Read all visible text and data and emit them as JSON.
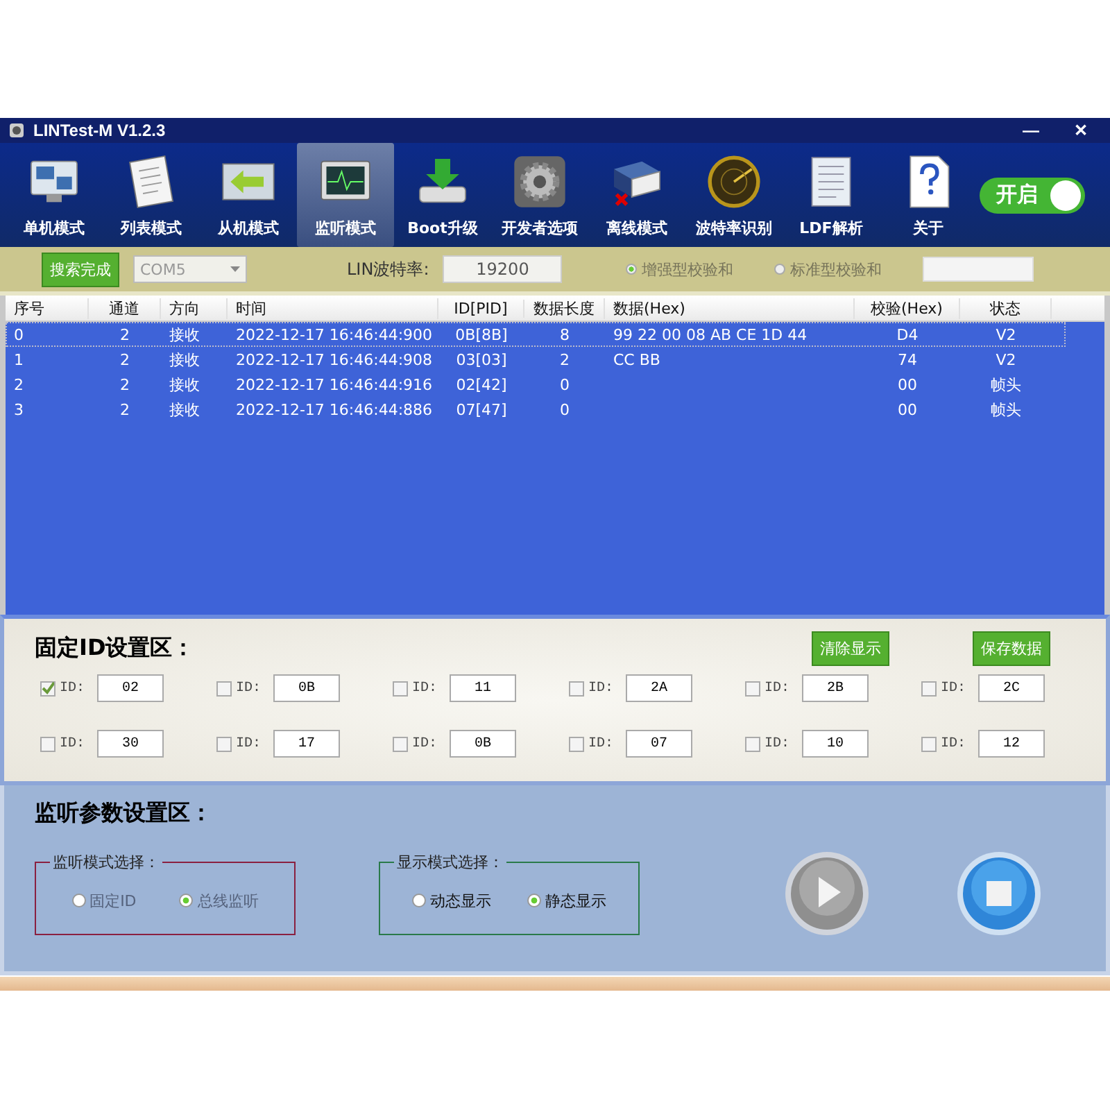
{
  "window": {
    "title": "LINTest-M V1.2.3",
    "controls": [
      "—",
      "✕"
    ]
  },
  "toolbar": {
    "items": [
      {
        "label": "单机模式",
        "selected": false
      },
      {
        "label": "列表模式",
        "selected": false
      },
      {
        "label": "从机模式",
        "selected": false
      },
      {
        "label": "监听模式",
        "selected": true
      },
      {
        "label": "Boot升级",
        "selected": false
      },
      {
        "label": "开发者选项",
        "selected": false
      },
      {
        "label": "离线模式",
        "selected": false
      },
      {
        "label": "波特率识别",
        "selected": false
      },
      {
        "label": "LDF解析",
        "selected": false
      },
      {
        "label": "关于",
        "selected": false
      }
    ],
    "toggle": {
      "label": "开启",
      "on": true
    }
  },
  "settings": {
    "search_button": "搜索完成",
    "port": {
      "value": "COM5",
      "disabled": true
    },
    "baud_label": "LIN波特率:",
    "baud_value": "19200",
    "checksum": [
      {
        "label": "增强型校验和",
        "selected": true,
        "disabled": true
      },
      {
        "label": "标准型校验和",
        "selected": false,
        "disabled": true
      }
    ]
  },
  "table": {
    "columns": [
      "序号",
      "通道",
      "方向",
      "时间",
      "ID[PID]",
      "数据长度",
      "数据(Hex)",
      "校验(Hex)",
      "状态"
    ],
    "rows": [
      {
        "cells": [
          "0",
          "2",
          "接收",
          "2022-12-17 16:46:44:900",
          "0B[8B]",
          "8",
          "99 22 00 08 AB CE 1D 44",
          "D4",
          "V2"
        ],
        "focused": true
      },
      {
        "cells": [
          "1",
          "2",
          "接收",
          "2022-12-17 16:46:44:908",
          "03[03]",
          "2",
          "CC BB",
          "74",
          "V2"
        ],
        "focused": false
      },
      {
        "cells": [
          "2",
          "2",
          "接收",
          "2022-12-17 16:46:44:916",
          "02[42]",
          "0",
          "",
          "00",
          "帧头"
        ],
        "focused": false
      },
      {
        "cells": [
          "3",
          "2",
          "接收",
          "2022-12-17 16:46:44:886",
          "07[47]",
          "0",
          "",
          "00",
          "帧头"
        ],
        "focused": false
      }
    ]
  },
  "fixed_id": {
    "title": "固定ID设置区：",
    "buttons": [
      "清除显示",
      "保存数据"
    ],
    "items": [
      {
        "label": "ID:",
        "value": "02",
        "checked": true
      },
      {
        "label": "ID:",
        "value": "0B",
        "checked": false
      },
      {
        "label": "ID:",
        "value": "11",
        "checked": false
      },
      {
        "label": "ID:",
        "value": "2A",
        "checked": false
      },
      {
        "label": "ID:",
        "value": "2B",
        "checked": false
      },
      {
        "label": "ID:",
        "value": "2C",
        "checked": false
      },
      {
        "label": "ID:",
        "value": "30",
        "checked": false
      },
      {
        "label": "ID:",
        "value": "17",
        "checked": false
      },
      {
        "label": "ID:",
        "value": "0B",
        "checked": false
      },
      {
        "label": "ID:",
        "value": "07",
        "checked": false
      },
      {
        "label": "ID:",
        "value": "10",
        "checked": false
      },
      {
        "label": "ID:",
        "value": "12",
        "checked": false
      }
    ]
  },
  "monitor": {
    "title": "监听参数设置区：",
    "groups": [
      {
        "title": "监听模式选择：",
        "color": "#8a2040",
        "options": [
          {
            "label": "固定ID",
            "selected": false,
            "disabled": true
          },
          {
            "label": "总线监听",
            "selected": true,
            "disabled": true
          }
        ]
      },
      {
        "title": "显示模式选择：",
        "color": "#2a7a4a",
        "options": [
          {
            "label": "动态显示",
            "selected": false,
            "disabled": false
          },
          {
            "label": "静态显示",
            "selected": true,
            "disabled": false
          }
        ]
      }
    ]
  }
}
